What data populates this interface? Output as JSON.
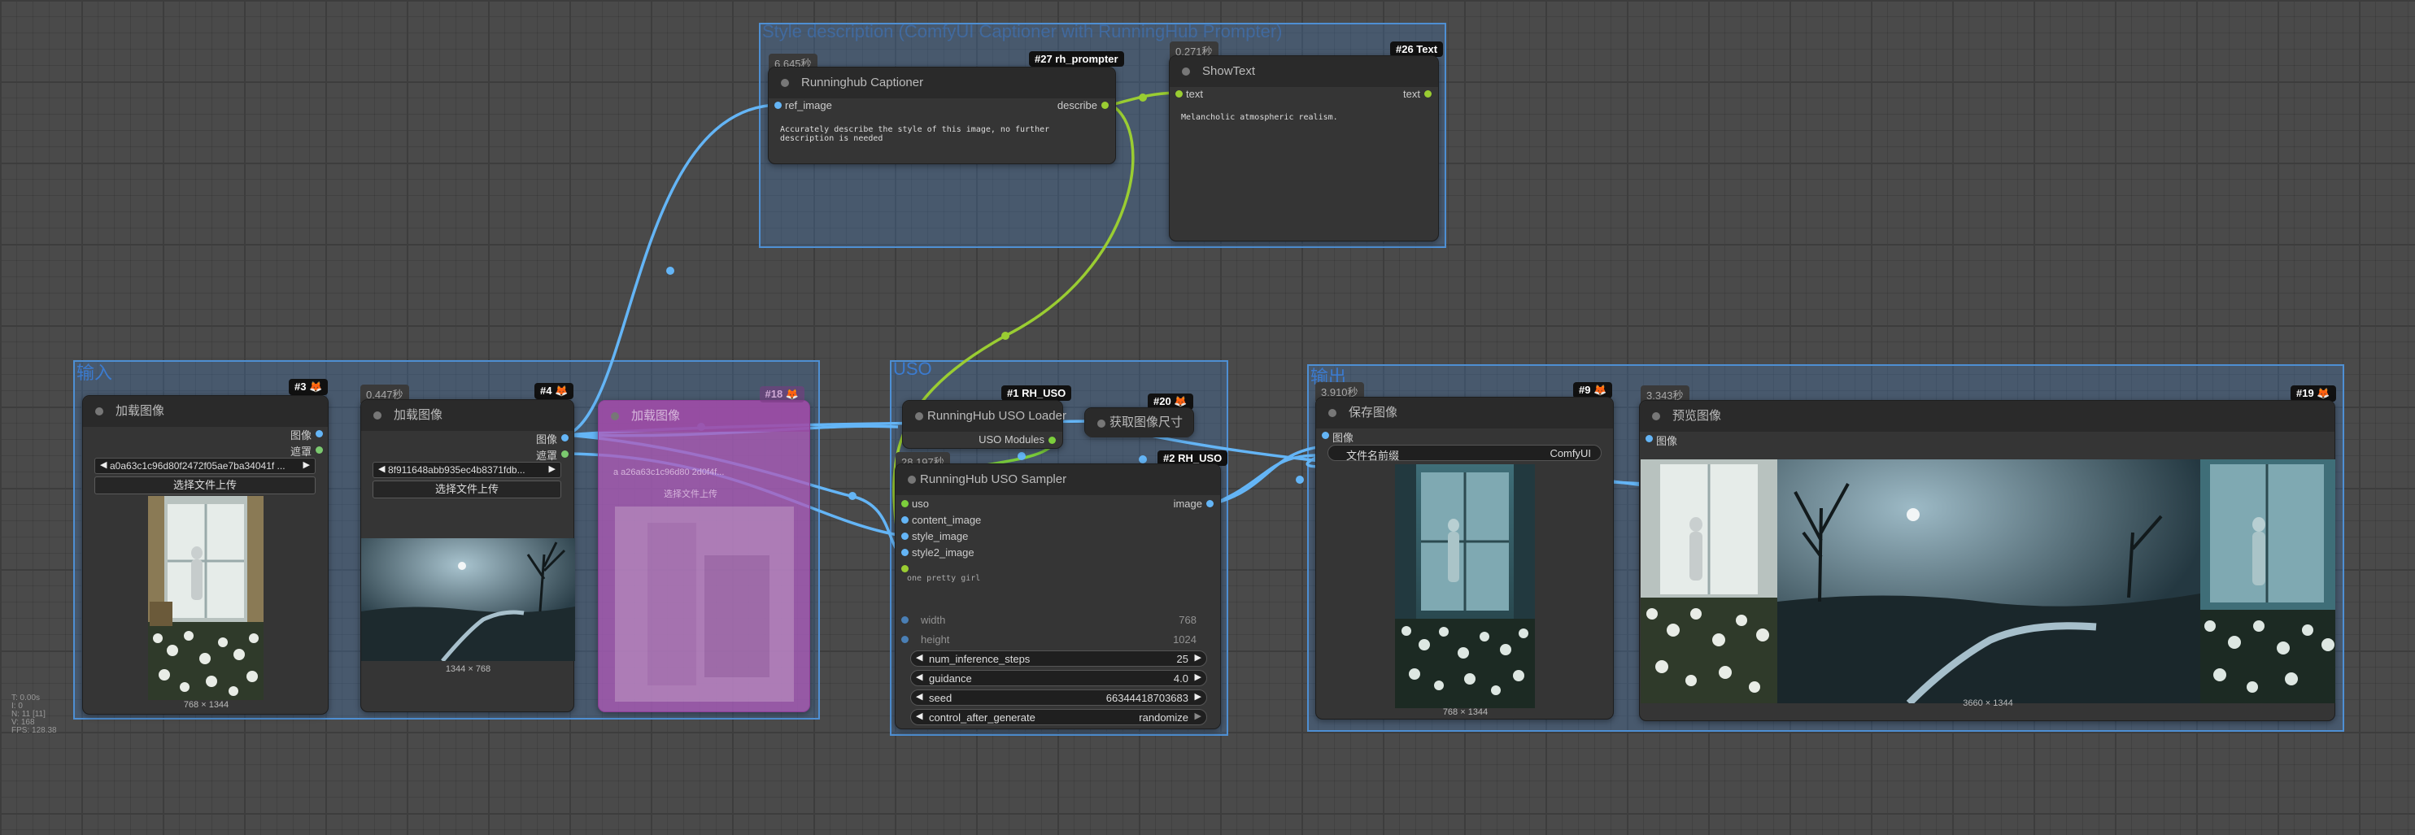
{
  "groups": [
    {
      "id": "g-top",
      "title": "Style description (ComfyUI Captioner with RunningHub Prompter)"
    },
    {
      "id": "g-input",
      "title": "输入"
    },
    {
      "id": "g-uso",
      "title": "USO"
    },
    {
      "id": "g-output",
      "title": "输出"
    }
  ],
  "nodes": {
    "load1": {
      "badge": "#3 🦊",
      "title": "加载图像",
      "out_image": "图像",
      "out_mask": "遮罩",
      "filename": "a0a63c1c96d80f2472f05ae7ba34041f ...",
      "upload": "选择文件上传",
      "dims": "768 × 1344"
    },
    "load2": {
      "time": "0.447秒",
      "badge": "#4 🦊",
      "title": "加载图像",
      "out_image": "图像",
      "out_mask": "遮罩",
      "filename": "8f911648abb935ec4b8371fdb...",
      "upload": "选择文件上传",
      "dims": "1344 × 768"
    },
    "bypassed": {
      "badge": "#18 🦊",
      "title": "加载图像",
      "text1": "a a26a63c1c96d80 2d0f4f...",
      "text2": "选择文件上传"
    },
    "captioner": {
      "time": "6.645秒",
      "badge": "#27 rh_prompter",
      "title": "Runninghub Captioner",
      "in_ref": "ref_image",
      "out_describe": "describe",
      "prompt": "Accurately describe the style of this image, no further description is needed"
    },
    "showtext": {
      "time": "0.271秒",
      "badge": "#26 Text",
      "title": "ShowText",
      "in_text": "text",
      "out_text": "text",
      "content": "Melancholic atmospheric realism."
    },
    "loader": {
      "badge": "#1 RH_USO",
      "title": "RunningHub USO Loader",
      "out": "USO Modules"
    },
    "getsize": {
      "badge": "#20 🦊",
      "title": "获取图像尺寸"
    },
    "sampler": {
      "time": "28.197秒",
      "badge": "#2 RH_USO",
      "title": "RunningHub USO Sampler",
      "inputs": [
        "uso",
        "content_image",
        "style_image",
        "style2_image"
      ],
      "out_image": "image",
      "prompt": "one pretty girl",
      "width_label": "width",
      "width_val": "768",
      "height_label": "height",
      "height_val": "1024",
      "steps_label": "num_inference_steps",
      "steps_val": "25",
      "guidance_label": "guidance",
      "guidance_val": "4.0",
      "seed_label": "seed",
      "seed_val": "66344418703683",
      "control_label": "control_after_generate",
      "control_val": "randomize"
    },
    "save": {
      "time": "3.910秒",
      "badge": "#9 🦊",
      "title": "保存图像",
      "in_image": "图像",
      "prefix_label": "文件名前缀",
      "prefix_val": "ComfyUI",
      "dims": "768 × 1344"
    },
    "preview": {
      "time": "3.343秒",
      "badge": "#19 🦊",
      "title": "预览图像",
      "in_image": "图像",
      "dims": "3660 × 1344"
    }
  },
  "stats": [
    "T: 0.00s",
    "I: 0",
    "N: 11 [11]",
    "V: 168",
    "FPS: 128.38"
  ],
  "colors": {
    "image": "#64b5f6",
    "string": "#9acd32",
    "uso": "#7ccf3c",
    "group": "#4e8fd3",
    "bypass": "#b05ab8",
    "canvas": "#4a4a4a"
  }
}
